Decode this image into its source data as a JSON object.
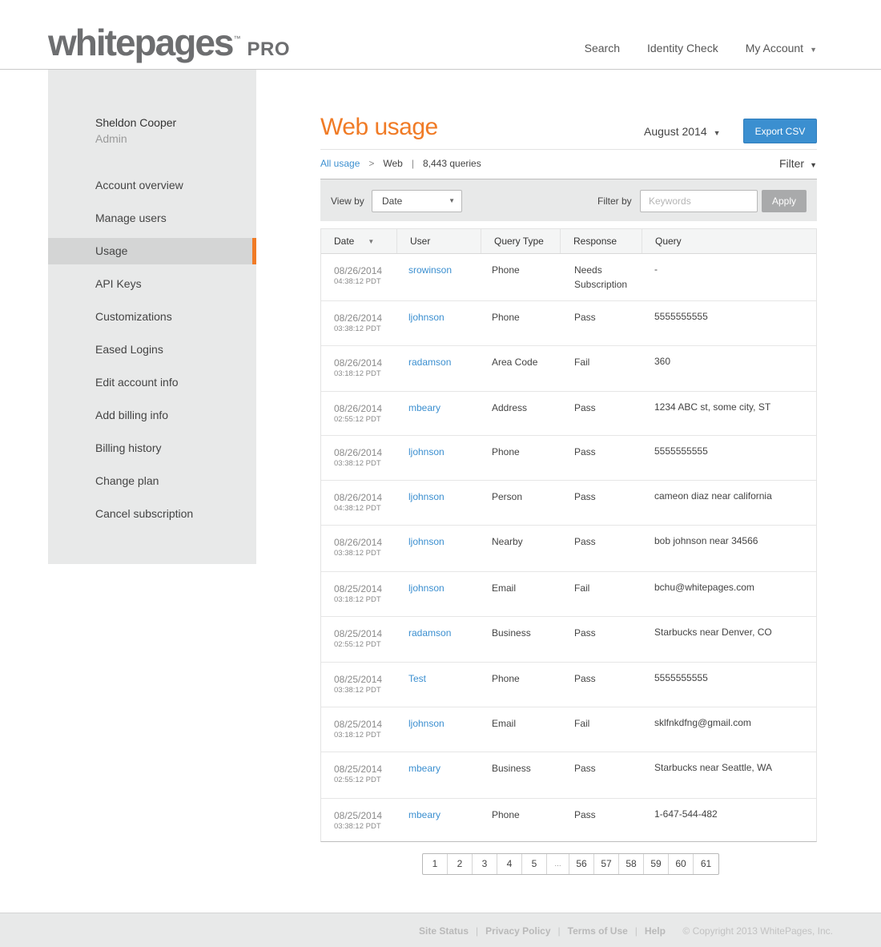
{
  "header": {
    "logo_main": "whitepages",
    "logo_tm": "™",
    "logo_pro": "PRO",
    "nav": [
      {
        "label": "Search"
      },
      {
        "label": "Identity Check"
      },
      {
        "label": "My Account"
      }
    ],
    "caret": "▼"
  },
  "sidebar": {
    "user_name": "Sheldon Cooper",
    "user_role": "Admin",
    "items": [
      {
        "label": "Account overview"
      },
      {
        "label": "Manage users"
      },
      {
        "label": "Usage"
      },
      {
        "label": "API Keys"
      },
      {
        "label": "Customizations"
      },
      {
        "label": "Eased Logins"
      },
      {
        "label": "Edit account info"
      },
      {
        "label": "Add billing info"
      },
      {
        "label": "Billing history"
      },
      {
        "label": "Change plan"
      },
      {
        "label": "Cancel subscription"
      }
    ],
    "active_index": 2
  },
  "main": {
    "title": "Web usage",
    "month": "August 2014",
    "export_label": "Export CSV",
    "breadcrumb": {
      "all_usage": "All usage",
      "sep": ">",
      "current": "Web",
      "divider": "|",
      "count": "8,443 queries"
    },
    "filter_label": "Filter",
    "toolbar": {
      "view_by_label": "View by",
      "view_by_value": "Date",
      "filter_by_label": "Filter by",
      "keyword_placeholder": "Keywords",
      "apply_label": "Apply"
    },
    "table": {
      "headers": [
        "Date",
        "User",
        "Query Type",
        "Response",
        "Query"
      ],
      "sort_icon": "▼",
      "rows": [
        {
          "date": "08/26/2014",
          "time": "04:38:12 PDT",
          "user": "srowinson",
          "type": "Phone",
          "response": "Needs Subscription",
          "query": "-"
        },
        {
          "date": "08/26/2014",
          "time": "03:38:12 PDT",
          "user": "ljohnson",
          "type": "Phone",
          "response": "Pass",
          "query": "5555555555"
        },
        {
          "date": "08/26/2014",
          "time": "03:18:12 PDT",
          "user": "radamson",
          "type": "Area Code",
          "response": "Fail",
          "query": "360"
        },
        {
          "date": "08/26/2014",
          "time": "02:55:12 PDT",
          "user": "mbeary",
          "type": "Address",
          "response": "Pass",
          "query": "1234 ABC st, some city, ST"
        },
        {
          "date": "08/26/2014",
          "time": "03:38:12 PDT",
          "user": "ljohnson",
          "type": "Phone",
          "response": "Pass",
          "query": "5555555555"
        },
        {
          "date": "08/26/2014",
          "time": "04:38:12 PDT",
          "user": "ljohnson",
          "type": "Person",
          "response": "Pass",
          "query": "cameon diaz near california"
        },
        {
          "date": "08/26/2014",
          "time": "03:38:12 PDT",
          "user": "ljohnson",
          "type": "Nearby",
          "response": "Pass",
          "query": "bob johnson near 34566"
        },
        {
          "date": "08/25/2014",
          "time": "03:18:12 PDT",
          "user": "ljohnson",
          "type": "Email",
          "response": "Fail",
          "query": "bchu@whitepages.com"
        },
        {
          "date": "08/25/2014",
          "time": "02:55:12 PDT",
          "user": "radamson",
          "type": "Business",
          "response": "Pass",
          "query": "Starbucks near Denver, CO"
        },
        {
          "date": "08/25/2014",
          "time": "03:38:12 PDT",
          "user": "Test",
          "type": "Phone",
          "response": "Pass",
          "query": "5555555555"
        },
        {
          "date": "08/25/2014",
          "time": "03:18:12 PDT",
          "user": "ljohnson",
          "type": "Email",
          "response": "Fail",
          "query": "sklfnkdfng@gmail.com"
        },
        {
          "date": "08/25/2014",
          "time": "02:55:12 PDT",
          "user": "mbeary",
          "type": "Business",
          "response": "Pass",
          "query": "Starbucks near Seattle, WA"
        },
        {
          "date": "08/25/2014",
          "time": "03:38:12 PDT",
          "user": "mbeary",
          "type": "Phone",
          "response": "Pass",
          "query": "1-647-544-482"
        }
      ]
    },
    "pagination": [
      "1",
      "2",
      "3",
      "4",
      "5",
      "...",
      "56",
      "57",
      "58",
      "59",
      "60",
      "61"
    ]
  },
  "footer": {
    "links": [
      "Site Status",
      "Privacy Policy",
      "Terms of Use",
      "Help"
    ],
    "divider": "|",
    "copyright": "© Copyright 2013 WhitePages, Inc."
  },
  "colors": {
    "accent_orange": "#f07b26",
    "link_blue": "#3b8fd0",
    "sidebar_bg": "#e8e9e9"
  }
}
